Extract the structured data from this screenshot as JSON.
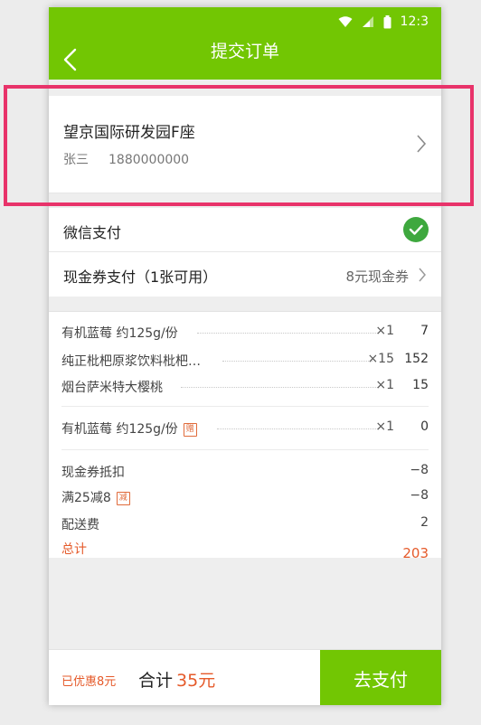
{
  "status_bar": {
    "time": "12:3"
  },
  "header": {
    "title": "提交订单"
  },
  "address": {
    "place": "望京国际研发园F座",
    "contact_name": "张三",
    "phone": "1880000000"
  },
  "payment": {
    "wechat_label": "微信支付",
    "coupon_label": "现金券支付（1张可用）",
    "coupon_value": "8元现金券"
  },
  "items": [
    {
      "name": "有机蓝莓 约125g/份",
      "qty": "×1",
      "price": "7"
    },
    {
      "name": "纯正枇杷原浆饮料枇杷…",
      "qty": "×15",
      "price": "152"
    },
    {
      "name": "烟台萨米特大樱桃",
      "qty": "×1",
      "price": "15"
    }
  ],
  "gift": {
    "name": "有机蓝莓 约125g/份",
    "tag": "赠",
    "qty": "×1",
    "price": "0"
  },
  "summary": {
    "coupon_label": "现金券抵扣",
    "coupon_value": "−8",
    "promo_label": "满25减8",
    "promo_tag": "减",
    "promo_value": "−8",
    "delivery_label": "配送费",
    "delivery_value": "2",
    "total_label": "总计",
    "total_value": "203"
  },
  "footer": {
    "saved": "已优惠8元",
    "sum_label": "合计",
    "sum_amount": "35元",
    "pay_button": "去支付"
  },
  "colors": {
    "brand_green": "#72c603",
    "check_green": "#3ea83e",
    "accent_orange": "#e55a2a",
    "highlight_pink": "#e8336a"
  }
}
